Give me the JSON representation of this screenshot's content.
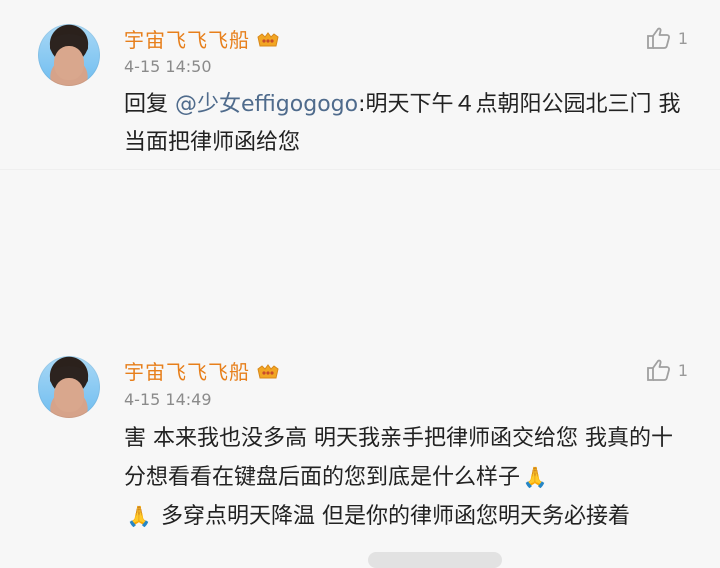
{
  "comments": [
    {
      "author": "宇宙飞飞飞船",
      "time": "4-15 14:50",
      "likes": "1",
      "reply_prefix": "回复 ",
      "mention": "@少女effigogogo",
      "body": ":明天下午４点朝阳公园北三门 我当面把律师函给您"
    },
    {
      "author": "宇宙飞飞飞船",
      "time": "4-15 14:49",
      "likes": "1",
      "body_part1": "害 本来我也没多高 明天我亲手把律师函交给您 我真的十分想看看在键盘后面的您到底是什么样子",
      "emoji1": "🙏",
      "emoji2": "🙏",
      "body_part2": " 多穿点明天降温  但是你的律师函您明天务必接着"
    }
  ]
}
